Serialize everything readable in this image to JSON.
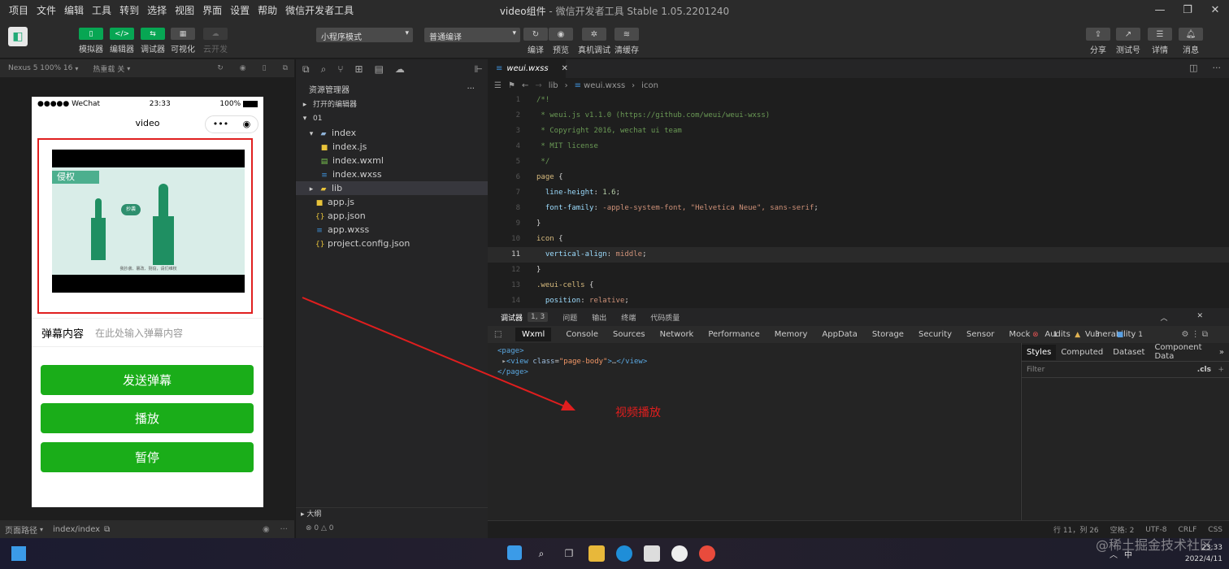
{
  "menu": [
    "项目",
    "文件",
    "编辑",
    "工具",
    "转到",
    "选择",
    "视图",
    "界面",
    "设置",
    "帮助",
    "微信开发者工具"
  ],
  "window": {
    "title": "video组件",
    "subtitle": "微信开发者工具 Stable 1.05.2201240"
  },
  "toolbar": {
    "simulator": "模拟器",
    "editor": "编辑器",
    "debugger": "调试器",
    "visual": "可视化",
    "cloud": "云开发",
    "mode": "小程序模式",
    "compile_mode": "普通编译",
    "compile": "编译",
    "preview": "预览",
    "real_debug": "真机调试",
    "clear_cache": "清缓存",
    "share": "分享",
    "test_id": "测试号",
    "details": "详情",
    "messages": "消息"
  },
  "simbar": {
    "device": "Nexus 5 100% 16",
    "hot_reload": "热重载 关"
  },
  "phone": {
    "carrier": "●●●●● WeChat",
    "time": "23:33",
    "battery": "100%",
    "nav_title": "video",
    "poster_tag": "侵权",
    "poster_bubble": "抄袭",
    "poster_caption": "我抄袭、篡改、剽窃，请们维权",
    "danmu_label": "弹幕内容",
    "danmu_placeholder": "在此处输入弹幕内容",
    "btn_send": "发送弹幕",
    "btn_play": "播放",
    "btn_pause": "暂停"
  },
  "left_footer": {
    "label": "页面路径",
    "path": "index/index"
  },
  "explorer": {
    "title": "资源管理器",
    "open_editors": "打开的编辑器",
    "project": "01",
    "items": [
      {
        "name": "index",
        "icon": "folder"
      },
      {
        "name": "index.js",
        "icon": "js"
      },
      {
        "name": "index.wxml",
        "icon": "wxml"
      },
      {
        "name": "index.wxss",
        "icon": "wxss"
      },
      {
        "name": "lib",
        "icon": "folder"
      },
      {
        "name": "app.js",
        "icon": "js"
      },
      {
        "name": "app.json",
        "icon": "json"
      },
      {
        "name": "app.wxss",
        "icon": "wxss"
      },
      {
        "name": "project.config.json",
        "icon": "json"
      }
    ],
    "outline": "大纲",
    "problems": "⊗ 0 △ 0"
  },
  "editor": {
    "tab": "weui.wxss",
    "crumbs": [
      "lib",
      "weui.wxss",
      "icon"
    ],
    "lines": [
      {
        "n": "1",
        "parts": [
          [
            "c-cm",
            "/*!"
          ]
        ]
      },
      {
        "n": "2",
        "parts": [
          [
            "c-cm",
            " * weui.js v1.1.0 (https://github.com/weui/weui-wxss)"
          ]
        ]
      },
      {
        "n": "3",
        "parts": [
          [
            "c-cm",
            " * Copyright 2016, wechat ui team"
          ]
        ]
      },
      {
        "n": "4",
        "parts": [
          [
            "c-cm",
            " * MIT license"
          ]
        ]
      },
      {
        "n": "5",
        "parts": [
          [
            "c-cm",
            " */"
          ]
        ]
      },
      {
        "n": "6",
        "parts": [
          [
            "c-sel",
            "page"
          ],
          [
            "c-pl",
            " {"
          ]
        ]
      },
      {
        "n": "7",
        "parts": [
          [
            "c-prop",
            "  line-height"
          ],
          [
            "c-pl",
            ": "
          ],
          [
            "c-num",
            "1.6"
          ],
          [
            "c-pl",
            ";"
          ]
        ]
      },
      {
        "n": "8",
        "parts": [
          [
            "c-prop",
            "  font-family"
          ],
          [
            "c-pl",
            ": "
          ],
          [
            "c-val",
            "-apple-system-font, \"Helvetica Neue\", sans-serif"
          ],
          [
            "c-pl",
            ";"
          ]
        ]
      },
      {
        "n": "9",
        "parts": [
          [
            "c-pl",
            "}"
          ]
        ]
      },
      {
        "n": "10",
        "parts": [
          [
            "c-sel",
            "icon"
          ],
          [
            "c-pl",
            " {"
          ]
        ]
      },
      {
        "n": "11",
        "parts": [
          [
            "c-prop",
            "  vertical-align"
          ],
          [
            "c-pl",
            ": "
          ],
          [
            "c-val",
            "middle"
          ],
          [
            "c-pl",
            ";"
          ]
        ]
      },
      {
        "n": "12",
        "parts": [
          [
            "c-pl",
            "}"
          ]
        ]
      },
      {
        "n": "13",
        "parts": [
          [
            "c-sel",
            ".weui-cells"
          ],
          [
            "c-pl",
            " {"
          ]
        ]
      },
      {
        "n": "14",
        "parts": [
          [
            "c-prop",
            "  position"
          ],
          [
            "c-pl",
            ": "
          ],
          [
            "c-val",
            "relative"
          ],
          [
            "c-pl",
            ";"
          ]
        ]
      }
    ]
  },
  "debug": {
    "tabs": [
      "调试器",
      "问题",
      "输出",
      "终端",
      "代码质量"
    ],
    "badge": "1, 3",
    "devtools": [
      "Wxml",
      "Console",
      "Sources",
      "Network",
      "Performance",
      "Memory",
      "AppData",
      "Storage",
      "Security",
      "Sensor",
      "Mock",
      "Audits",
      "Vulnerability"
    ],
    "err_count": "1",
    "warn_count": "3",
    "info_count": "1",
    "styles_tabs": [
      "Styles",
      "Computed",
      "Dataset",
      "Component Data"
    ],
    "filter": "Filter",
    "cls": ".cls"
  },
  "annotation": "视频播放",
  "statusbar": [
    "行 11，列 26",
    "空格: 2",
    "UTF-8",
    "CRLF",
    "CSS"
  ],
  "taskbar": {
    "time": "23:33",
    "date": "2022/4/11",
    "lang": "中"
  },
  "watermark": "@稀土掘金技术社区",
  "colors": {
    "accent_green": "#07a653",
    "button_green": "#1aad19",
    "annotation_red": "#e01e1e"
  }
}
